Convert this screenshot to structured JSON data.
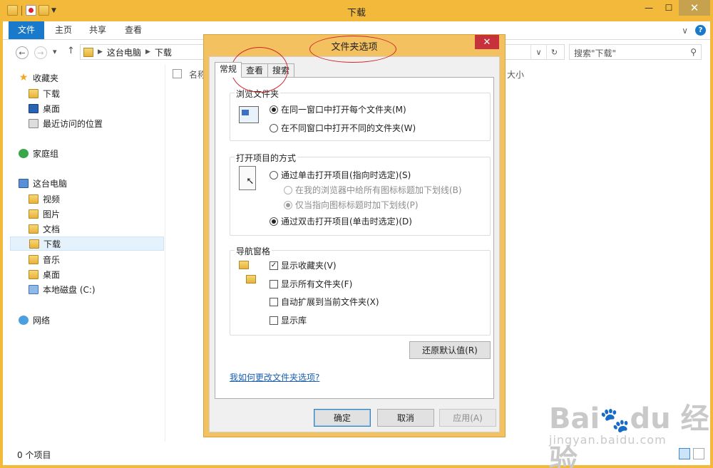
{
  "explorer": {
    "title": "下载",
    "ribbon_tabs": [
      "文件",
      "主页",
      "共享",
      "查看"
    ],
    "breadcrumb": [
      "这台电脑",
      "下载"
    ],
    "search_placeholder": "搜索\"下载\"",
    "columns": {
      "name": "名称",
      "size": "大小"
    },
    "nav": {
      "favorites": "收藏夹",
      "fav_items": [
        "下载",
        "桌面",
        "最近访问的位置"
      ],
      "homegroup": "家庭组",
      "this_pc": "这台电脑",
      "pc_items": [
        "视频",
        "图片",
        "文档",
        "下载",
        "音乐",
        "桌面",
        "本地磁盘 (C:)"
      ],
      "network": "网络"
    },
    "status": "0 个项目",
    "window_buttons": {
      "minimize": "—",
      "maximize": "☐",
      "close": "✕"
    },
    "help": "?",
    "ribbon_expand": "∨"
  },
  "dialog": {
    "title": "文件夹选项",
    "close": "✕",
    "tabs": [
      "常规",
      "查看",
      "搜索"
    ],
    "active_tab": "常规",
    "group_browse": {
      "title": "浏览文件夹",
      "options": [
        "在同一窗口中打开每个文件夹(M)",
        "在不同窗口中打开不同的文件夹(W)"
      ]
    },
    "group_click": {
      "title": "打开项目的方式",
      "single": "通过单击打开项目(指向时选定)(S)",
      "underline_all": "在我的浏览器中给所有图标标题加下划线(B)",
      "underline_point": "仅当指向图标标题时加下划线(P)",
      "double": "通过双击打开项目(单击时选定)(D)"
    },
    "group_nav": {
      "title": "导航窗格",
      "options": [
        "显示收藏夹(V)",
        "显示所有文件夹(F)",
        "自动扩展到当前文件夹(X)",
        "显示库"
      ],
      "checked": [
        true,
        false,
        false,
        false
      ]
    },
    "restore_button": "还原默认值(R)",
    "help_link": "我如何更改文件夹选项?",
    "ok_button": "确定",
    "cancel_button": "取消",
    "apply_button": "应用(A)"
  },
  "watermark": {
    "brand": "Bai du 经验",
    "url": "jingyan.baidu.com"
  },
  "colors": {
    "window_frame": "#f3b93b",
    "accent": "#1979ca",
    "close_red": "#c7313b",
    "annotation": "#d2262b"
  }
}
